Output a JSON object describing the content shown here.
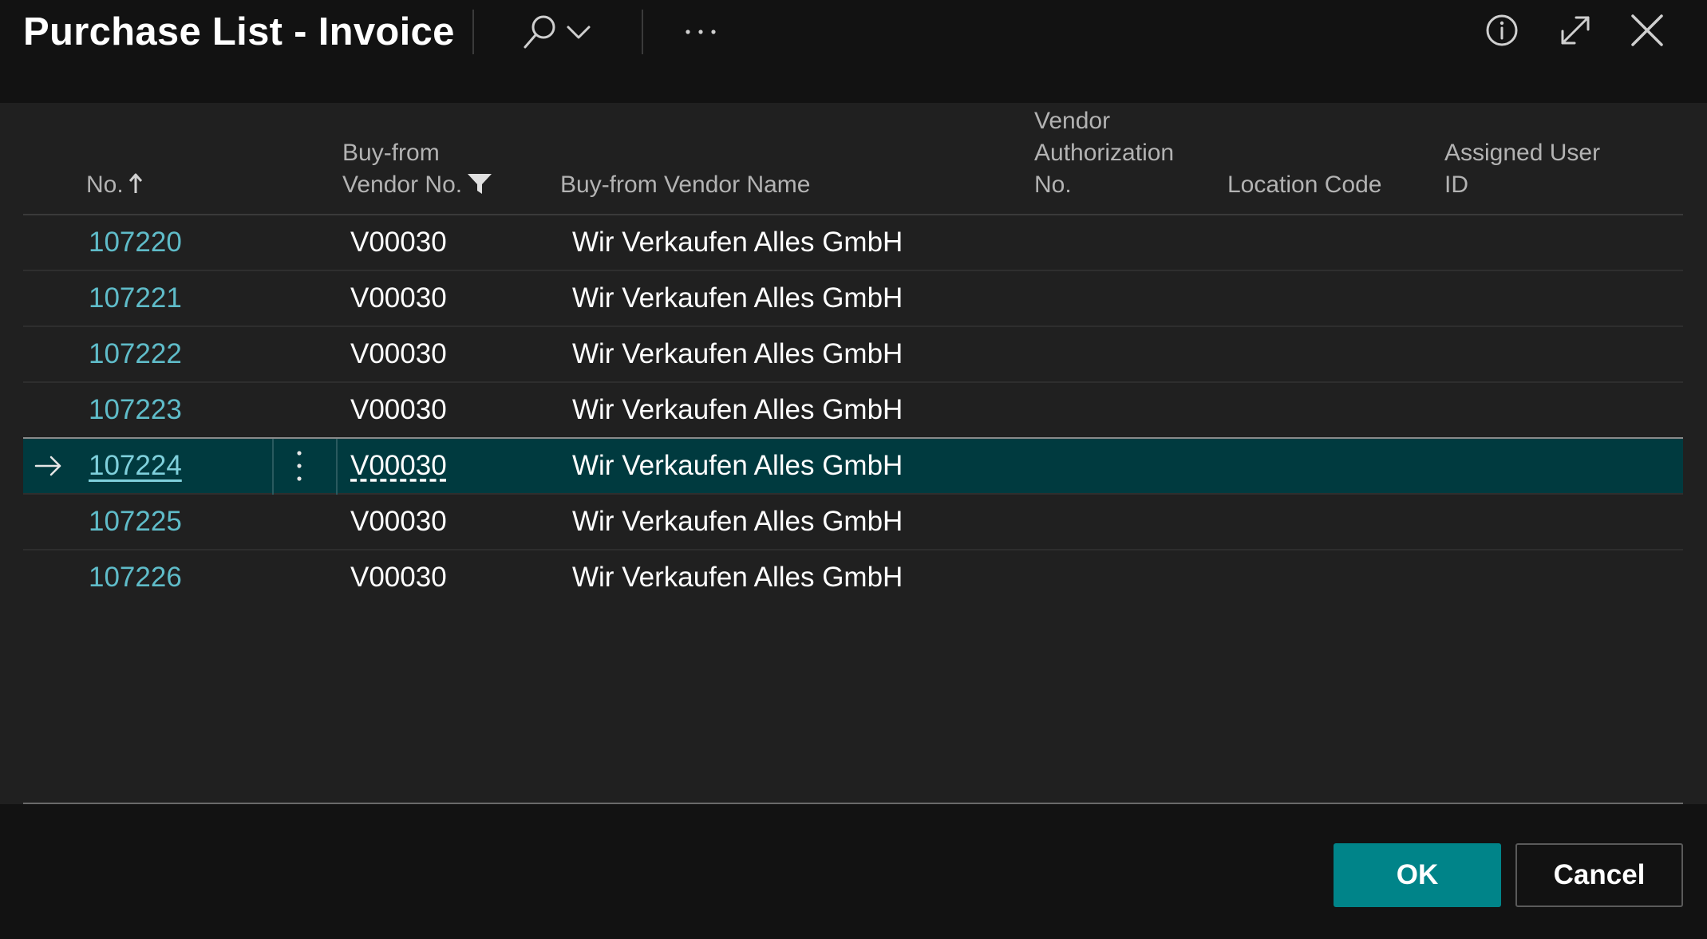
{
  "window": {
    "title": "Purchase List - Invoice",
    "icons": {
      "search": "search-icon",
      "search_dropdown": "chevron-down-icon",
      "more": "more-options-icon",
      "info": "info-icon",
      "expand": "expand-icon",
      "close": "close-icon"
    }
  },
  "grid": {
    "columns": {
      "no": {
        "label": "No.",
        "sorted": "ascending"
      },
      "vendor_no": {
        "line1": "Buy-from",
        "line2": "Vendor No.",
        "filtered": true
      },
      "vendor_name": {
        "label": "Buy-from Vendor Name"
      },
      "vendor_auth": {
        "line1": "Vendor",
        "line2": "Authorization",
        "line3": "No."
      },
      "location": {
        "label": "Location Code"
      },
      "assigned_user": {
        "line1": "Assigned User",
        "line2": "ID"
      }
    },
    "rows": [
      {
        "no": "107220",
        "vendor_no": "V00030",
        "vendor_name": "Wir Verkaufen Alles GmbH",
        "selected": false
      },
      {
        "no": "107221",
        "vendor_no": "V00030",
        "vendor_name": "Wir Verkaufen Alles GmbH",
        "selected": false
      },
      {
        "no": "107222",
        "vendor_no": "V00030",
        "vendor_name": "Wir Verkaufen Alles GmbH",
        "selected": false
      },
      {
        "no": "107223",
        "vendor_no": "V00030",
        "vendor_name": "Wir Verkaufen Alles GmbH",
        "selected": false
      },
      {
        "no": "107224",
        "vendor_no": "V00030",
        "vendor_name": "Wir Verkaufen Alles GmbH",
        "selected": true
      },
      {
        "no": "107225",
        "vendor_no": "V00030",
        "vendor_name": "Wir Verkaufen Alles GmbH",
        "selected": false
      },
      {
        "no": "107226",
        "vendor_no": "V00030",
        "vendor_name": "Wir Verkaufen Alles GmbH",
        "selected": false
      }
    ]
  },
  "footer": {
    "ok_label": "OK",
    "cancel_label": "Cancel"
  },
  "colors": {
    "background": "#121212",
    "grid_background": "#202020",
    "accent": "#008489",
    "link": "#5fbcc9",
    "selected_row": "#003a3f"
  }
}
